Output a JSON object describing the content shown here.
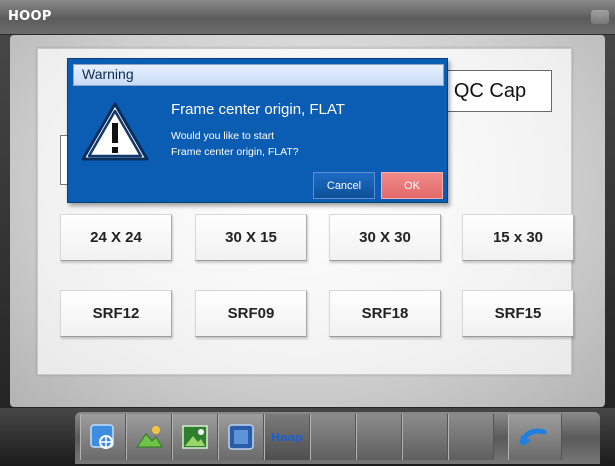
{
  "window": {
    "title": "HOOP"
  },
  "tabs": {
    "active_label": "QC Cap"
  },
  "hoops": {
    "row1": [
      {
        "label": "24 X 24"
      },
      {
        "label": "30 X 15"
      },
      {
        "label": "30 X 30"
      },
      {
        "label": "15 x 30"
      }
    ],
    "row2": [
      {
        "label": "SRF12"
      },
      {
        "label": "SRF09"
      },
      {
        "label": "SRF18"
      },
      {
        "label": "SRF15"
      }
    ]
  },
  "dialog": {
    "title": "Warning",
    "heading": "Frame center origin, FLAT",
    "line1": "Would you like to start",
    "line2": "Frame center origin, FLAT?",
    "cancel_label": "Cancel",
    "ok_label": "OK",
    "icon": "warning-triangle-icon"
  },
  "toolbar": {
    "hoop_label": "Hoop",
    "icons": [
      "frame-move-icon",
      "design-landscape-icon",
      "image-icon",
      "screen-frame-icon",
      "back-arrow-icon"
    ]
  },
  "colors": {
    "dialog_bg": "#0b5db3",
    "ok_button": "#e36a6a",
    "hoop_text": "#1a5fd4"
  }
}
